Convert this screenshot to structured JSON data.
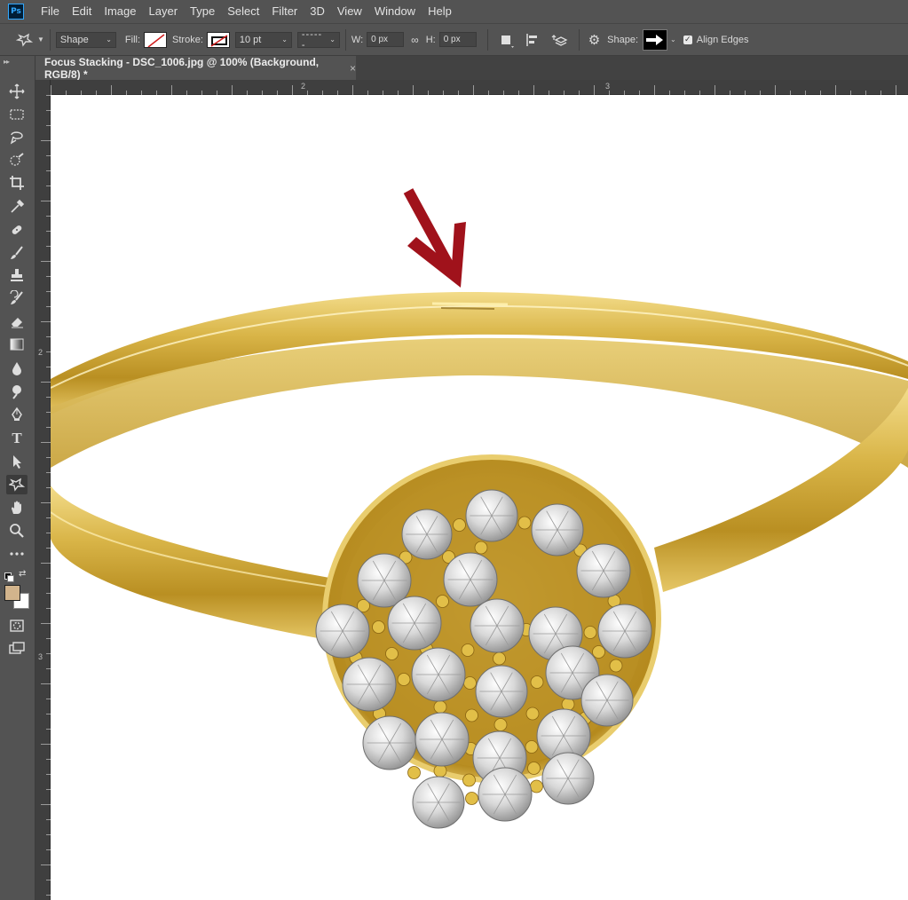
{
  "app": {
    "logo_text": "Ps"
  },
  "menu": [
    "File",
    "Edit",
    "Image",
    "Layer",
    "Type",
    "Select",
    "Filter",
    "3D",
    "View",
    "Window",
    "Help"
  ],
  "options": {
    "mode": "Shape",
    "fill_label": "Fill:",
    "stroke_label": "Stroke:",
    "stroke_width": "10 pt",
    "w_label": "W:",
    "w_value": "0 px",
    "h_label": "H:",
    "h_value": "0 px",
    "shape_label": "Shape:",
    "align_edges_label": "Align Edges",
    "align_edges_checked": true
  },
  "document": {
    "tab_title": "Focus Stacking - DSC_1006.jpg @ 100% (Background, RGB/8) *",
    "close_glyph": "×"
  },
  "rulers": {
    "top_labels": [
      "2",
      "3"
    ],
    "left_labels": [
      "2",
      "3"
    ]
  },
  "tools": [
    {
      "name": "move-tool",
      "icon": "move-icon"
    },
    {
      "name": "marquee-tool",
      "icon": "rect-marquee-icon"
    },
    {
      "name": "lasso-tool",
      "icon": "lasso-icon"
    },
    {
      "name": "quick-select-tool",
      "icon": "quick-select-icon"
    },
    {
      "name": "crop-tool",
      "icon": "crop-icon"
    },
    {
      "name": "eyedropper-tool",
      "icon": "eyedropper-icon"
    },
    {
      "name": "healing-tool",
      "icon": "bandage-icon"
    },
    {
      "name": "brush-tool",
      "icon": "brush-icon"
    },
    {
      "name": "stamp-tool",
      "icon": "stamp-icon"
    },
    {
      "name": "history-brush-tool",
      "icon": "history-brush-icon"
    },
    {
      "name": "eraser-tool",
      "icon": "eraser-icon"
    },
    {
      "name": "gradient-tool",
      "icon": "gradient-icon"
    },
    {
      "name": "blur-tool",
      "icon": "drop-icon"
    },
    {
      "name": "dodge-tool",
      "icon": "dodge-icon"
    },
    {
      "name": "pen-tool",
      "icon": "pen-icon"
    },
    {
      "name": "type-tool",
      "icon": "type-icon"
    },
    {
      "name": "path-select-tool",
      "icon": "arrow-icon"
    },
    {
      "name": "custom-shape-tool",
      "icon": "custom-shape-icon",
      "active": true
    },
    {
      "name": "hand-tool",
      "icon": "hand-icon"
    },
    {
      "name": "zoom-tool",
      "icon": "zoom-icon"
    },
    {
      "name": "more-tools",
      "icon": "ellipsis-icon"
    }
  ],
  "type_tool_glyph": "T",
  "colors": {
    "foreground": "#d2b48c",
    "background": "#ffffff",
    "annotation_arrow": "#a0121b",
    "gold": "#d4b03c"
  }
}
